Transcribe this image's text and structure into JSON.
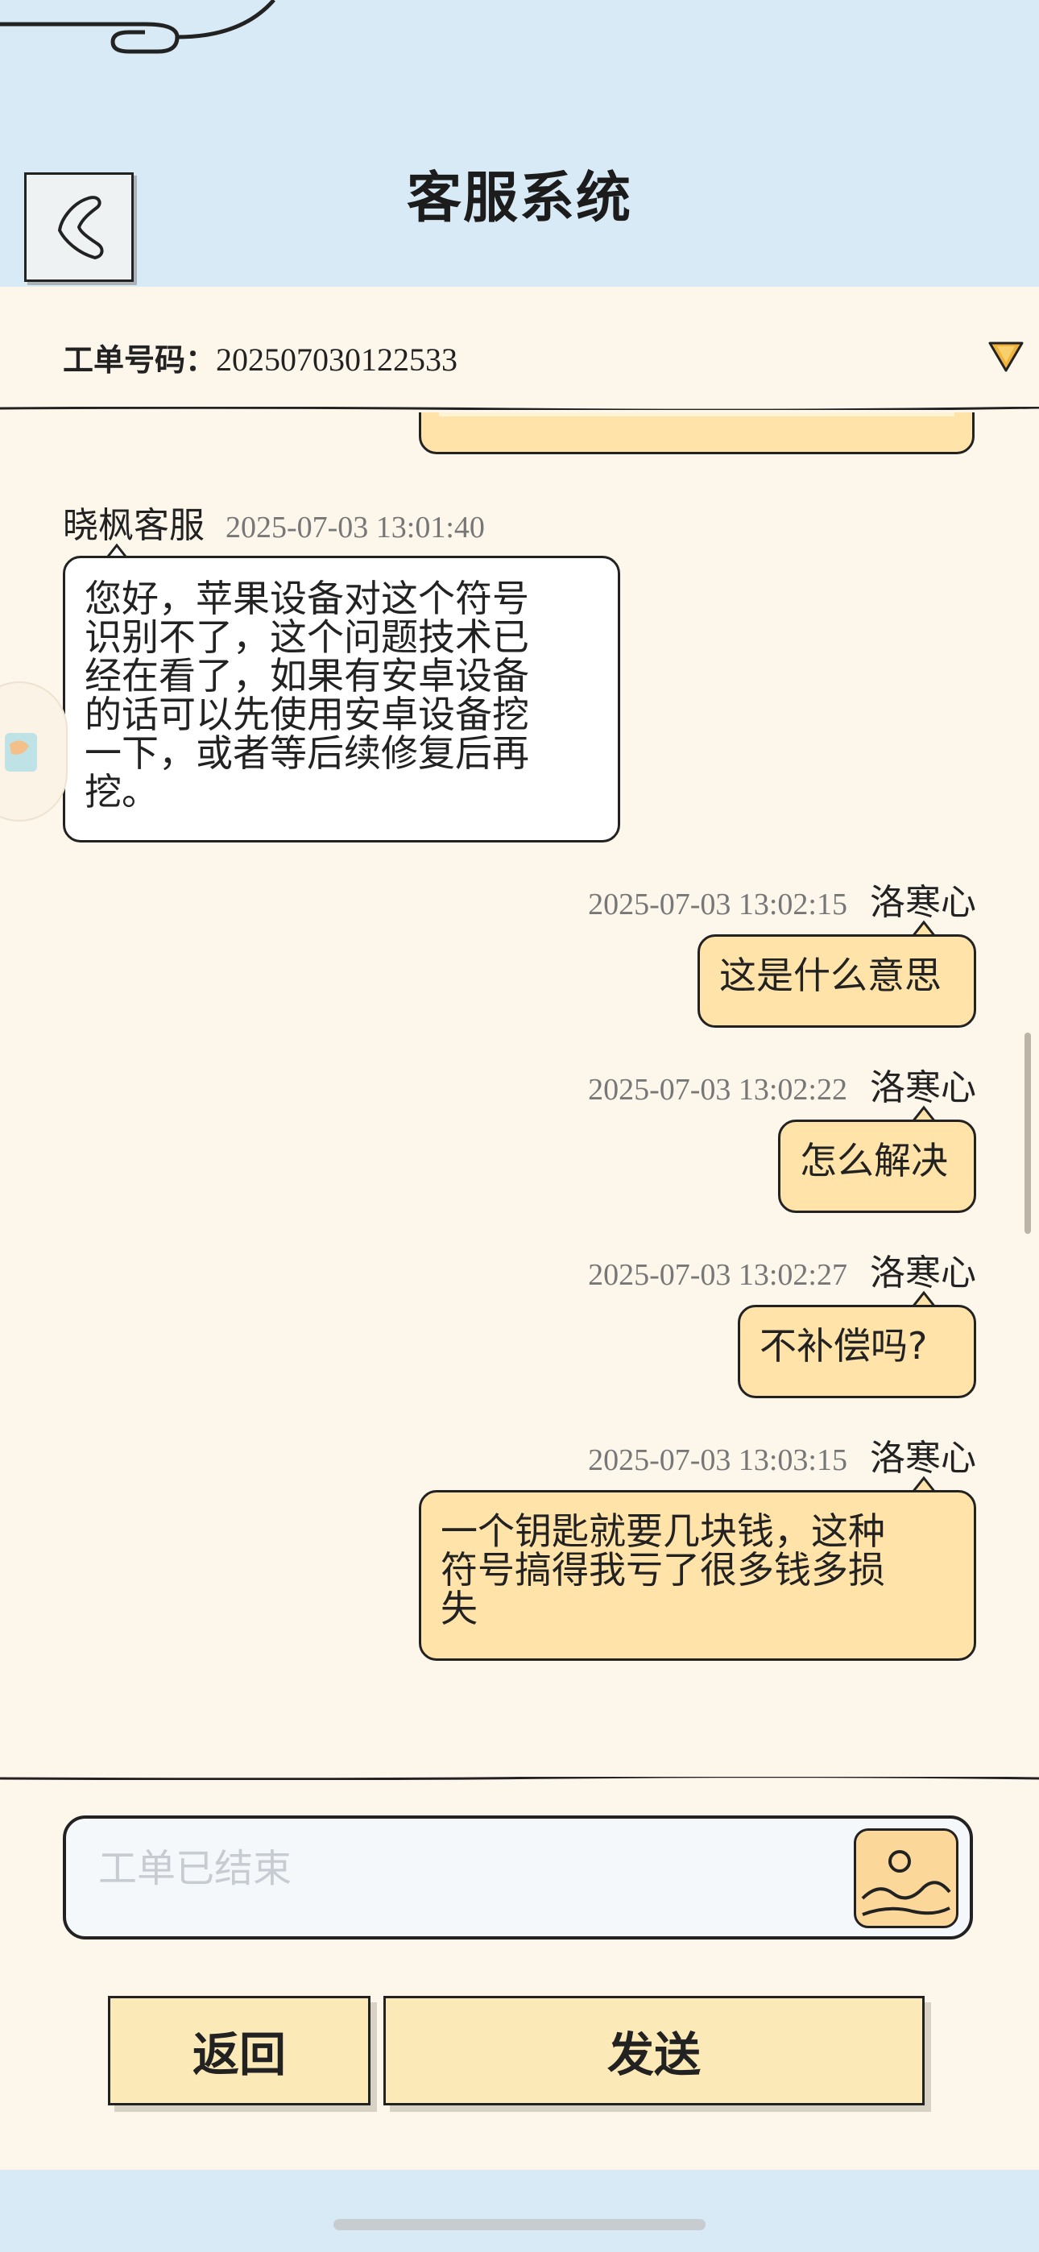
{
  "header": {
    "title": "客服系统",
    "back_icon": "back-chevron-icon"
  },
  "ticket": {
    "label": "工单号码：",
    "number": "202507030122533",
    "dropdown_icon": "triangle-down-icon"
  },
  "messages": [
    {
      "sender": "晓枫客服",
      "time": "2025-07-03 13:01:40",
      "side": "left",
      "text_lines": [
        "您好，苹果设备对这个符号",
        "识别不了，这个问题技术已",
        "经在看了，如果有安卓设备",
        "的话可以先使用安卓设备挖",
        "一下，或者等后续修复后再",
        "挖。"
      ]
    },
    {
      "sender": "洛寒心",
      "time": "2025-07-03 13:02:15",
      "side": "right",
      "text_lines": [
        "这是什么意思"
      ]
    },
    {
      "sender": "洛寒心",
      "time": "2025-07-03 13:02:22",
      "side": "right",
      "text_lines": [
        "怎么解决"
      ]
    },
    {
      "sender": "洛寒心",
      "time": "2025-07-03 13:02:27",
      "side": "right",
      "text_lines": [
        "不补偿吗?"
      ]
    },
    {
      "sender": "洛寒心",
      "time": "2025-07-03 13:03:15",
      "side": "right",
      "text_lines": [
        "一个钥匙就要几块钱，这种",
        "符号搞得我亏了很多钱多损",
        "失"
      ]
    }
  ],
  "input": {
    "placeholder": "工单已结束",
    "image_icon": "image-upload-icon"
  },
  "buttons": {
    "back_label": "返回",
    "send_label": "发送"
  },
  "colors": {
    "header_bg": "#d8eaf5",
    "page_bg": "#fdf6ea",
    "user_bubble": "#ffe3a8",
    "agent_bubble": "#ffffff",
    "button_bg": "#fbe9b7"
  }
}
